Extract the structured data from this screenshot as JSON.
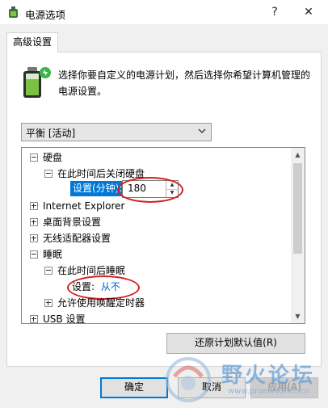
{
  "window": {
    "title": "电源选项",
    "help_glyph": "?",
    "close_glyph": "✕"
  },
  "tab": {
    "label": "高级设置"
  },
  "description": "选择你要自定义的电源计划，然后选择你希望计算机管理的电源设置。",
  "plan_select": {
    "value": "平衡 [活动]"
  },
  "tree": {
    "hard_disk": "硬盘",
    "turn_off_disk": "在此时间后关闭硬盘",
    "setting_label": "设置(分钟):",
    "setting_value": "180",
    "ie": "Internet Explorer",
    "desktop_bg": "桌面背景设置",
    "wireless": "无线适配器设置",
    "sleep": "睡眠",
    "sleep_after": "在此时间后睡眠",
    "sleep_setting_label": "设置:",
    "sleep_setting_value": "从不",
    "wake_timers": "允许使用唤醒定时器",
    "usb": "USB 设置"
  },
  "buttons": {
    "restore": "还原计划默认值(R)",
    "ok": "确定",
    "cancel": "取消",
    "apply": "应用(A)"
  },
  "watermark": {
    "text": "野火论坛",
    "url": "www.proewildfire.cn"
  },
  "colors": {
    "selection": "#0078d7",
    "annotation_red": "#d42020",
    "link_blue": "#0066cc"
  }
}
